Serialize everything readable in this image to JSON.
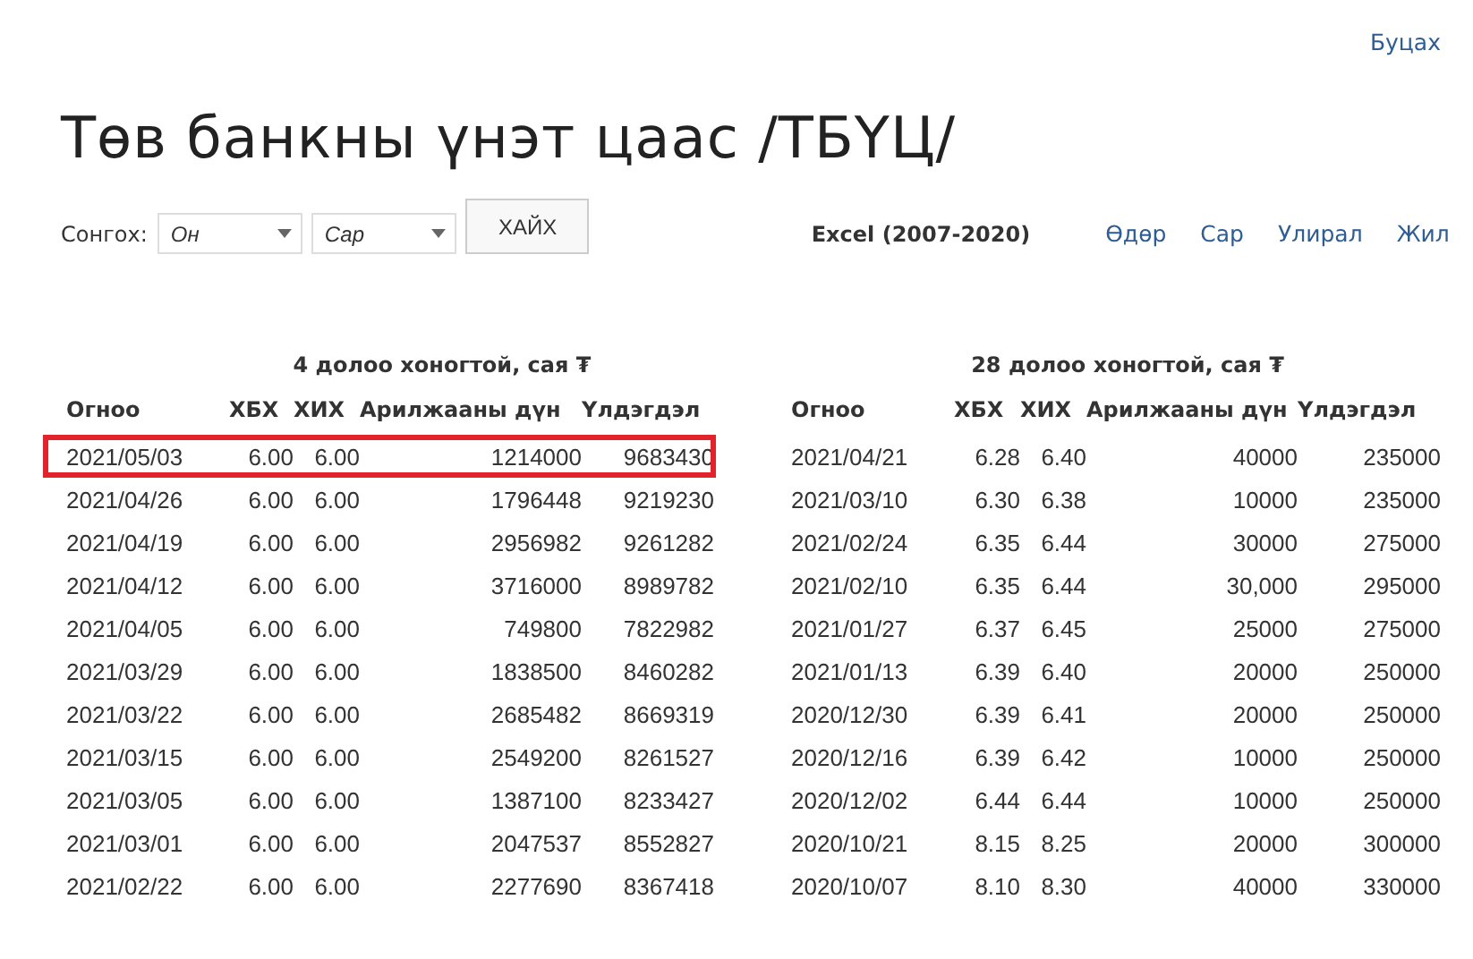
{
  "back_link": "Буцах",
  "title": "Төв банкны үнэт цаас /ТБҮЦ/",
  "filter": {
    "label": "Сонгох:",
    "year_select": {
      "placeholder": "Он"
    },
    "month_select": {
      "placeholder": "Сар"
    },
    "search_button": "ХАЙХ"
  },
  "excel_label": "Excel (2007-2020)",
  "period_links": [
    "Өдөр",
    "Сар",
    "Улирал",
    "Жил"
  ],
  "tables": [
    {
      "title": "4 долоо хоногтой, сая ₮",
      "columns": [
        "Огноо",
        "ХБХ",
        "ХИХ",
        "Арилжааны дүн",
        "Үлдэгдэл"
      ],
      "rows": [
        {
          "cells": [
            "2021/05/03",
            "6.00",
            "6.00",
            "1214000",
            "9683430"
          ],
          "highlighted": true
        },
        {
          "cells": [
            "2021/04/26",
            "6.00",
            "6.00",
            "1796448",
            "9219230"
          ],
          "highlighted": false
        },
        {
          "cells": [
            "2021/04/19",
            "6.00",
            "6.00",
            "2956982",
            "9261282"
          ],
          "highlighted": false
        },
        {
          "cells": [
            "2021/04/12",
            "6.00",
            "6.00",
            "3716000",
            "8989782"
          ],
          "highlighted": false
        },
        {
          "cells": [
            "2021/04/05",
            "6.00",
            "6.00",
            "749800",
            "7822982"
          ],
          "highlighted": false
        },
        {
          "cells": [
            "2021/03/29",
            "6.00",
            "6.00",
            "1838500",
            "8460282"
          ],
          "highlighted": false
        },
        {
          "cells": [
            "2021/03/22",
            "6.00",
            "6.00",
            "2685482",
            "8669319"
          ],
          "highlighted": false
        },
        {
          "cells": [
            "2021/03/15",
            "6.00",
            "6.00",
            "2549200",
            "8261527"
          ],
          "highlighted": false
        },
        {
          "cells": [
            "2021/03/05",
            "6.00",
            "6.00",
            "1387100",
            "8233427"
          ],
          "highlighted": false
        },
        {
          "cells": [
            "2021/03/01",
            "6.00",
            "6.00",
            "2047537",
            "8552827"
          ],
          "highlighted": false
        },
        {
          "cells": [
            "2021/02/22",
            "6.00",
            "6.00",
            "2277690",
            "8367418"
          ],
          "highlighted": false
        }
      ]
    },
    {
      "title": "28 долоо хоногтой, сая ₮",
      "columns": [
        "Огноо",
        "ХБХ",
        "ХИХ",
        "Арилжааны дүн",
        "Үлдэгдэл"
      ],
      "rows": [
        {
          "cells": [
            "2021/04/21",
            "6.28",
            "6.40",
            "40000",
            "235000"
          ],
          "highlighted": false
        },
        {
          "cells": [
            "2021/03/10",
            "6.30",
            "6.38",
            "10000",
            "235000"
          ],
          "highlighted": false
        },
        {
          "cells": [
            "2021/02/24",
            "6.35",
            "6.44",
            "30000",
            "275000"
          ],
          "highlighted": false
        },
        {
          "cells": [
            "2021/02/10",
            "6.35",
            "6.44",
            "30,000",
            "295000"
          ],
          "highlighted": false
        },
        {
          "cells": [
            "2021/01/27",
            "6.37",
            "6.45",
            "25000",
            "275000"
          ],
          "highlighted": false
        },
        {
          "cells": [
            "2021/01/13",
            "6.39",
            "6.40",
            "20000",
            "250000"
          ],
          "highlighted": false
        },
        {
          "cells": [
            "2020/12/30",
            "6.39",
            "6.41",
            "20000",
            "250000"
          ],
          "highlighted": false
        },
        {
          "cells": [
            "2020/12/16",
            "6.39",
            "6.42",
            "10000",
            "250000"
          ],
          "highlighted": false
        },
        {
          "cells": [
            "2020/12/02",
            "6.44",
            "6.44",
            "10000",
            "250000"
          ],
          "highlighted": false
        },
        {
          "cells": [
            "2020/10/21",
            "8.15",
            "8.25",
            "20000",
            "300000"
          ],
          "highlighted": false
        },
        {
          "cells": [
            "2020/10/07",
            "8.10",
            "8.30",
            "40000",
            "330000"
          ],
          "highlighted": false
        }
      ]
    }
  ]
}
